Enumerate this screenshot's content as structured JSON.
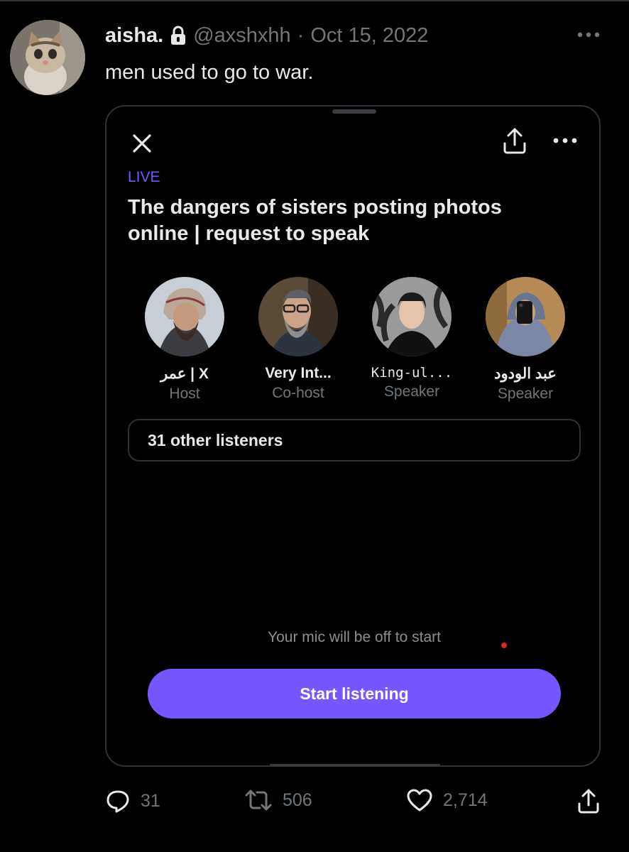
{
  "tweet": {
    "display_name": "aisha.",
    "handle": "@axshxhh",
    "separator": "·",
    "date": "Oct 15, 2022",
    "text": "men used to go to war."
  },
  "space": {
    "live_label": "LIVE",
    "title": "The dangers of sisters posting photos online | request to speak",
    "participants": [
      {
        "name": "عمر | X",
        "role": "Host"
      },
      {
        "name": "Very Int...",
        "role": "Co-host"
      },
      {
        "name": "King-ul...",
        "role": "Speaker"
      },
      {
        "name": "عبد الودود",
        "role": "Speaker"
      }
    ],
    "listeners_label": "31 other listeners",
    "mic_note": "Your mic will be off to start",
    "start_button_label": "Start listening"
  },
  "actions": {
    "replies": "31",
    "retweets": "506",
    "likes": "2,714"
  },
  "colors": {
    "accent": "#7856ff",
    "background": "#000000",
    "muted_text": "#71767b",
    "border": "#2f3336"
  }
}
